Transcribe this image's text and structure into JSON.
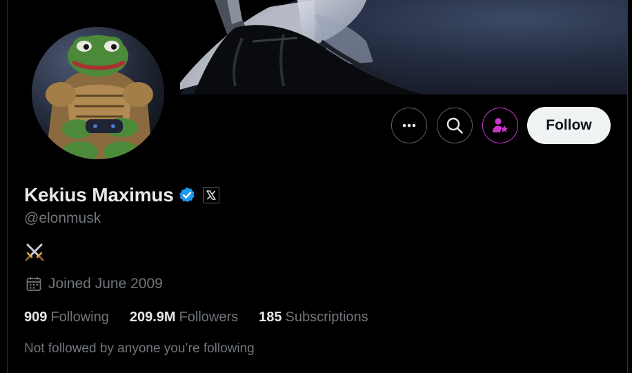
{
  "profile": {
    "display_name": "Kekius Maximus",
    "handle": "@elonmusk",
    "bio_emoji": "⚔️",
    "joined": "Joined June 2009",
    "not_followed_note": "Not followed by anyone you’re following"
  },
  "actions": {
    "more_icon": "more-icon",
    "search_icon": "search-icon",
    "subscribe_icon": "person-star-icon",
    "follow_label": "Follow"
  },
  "badges": {
    "verified_icon": "verified-badge-icon",
    "affiliate_icon": "x-logo-icon"
  },
  "stats": {
    "following_count": "909",
    "following_label": "Following",
    "followers_count": "209.9M",
    "followers_label": "Followers",
    "subscriptions_count": "185",
    "subscriptions_label": "Subscriptions"
  },
  "colors": {
    "background": "#000000",
    "primary_text": "#e7e9ea",
    "secondary_text": "#71767b",
    "verified_blue": "#1d9bf0",
    "subscribe_pink": "#c936cc",
    "follow_button_bg": "#eff3f4"
  }
}
